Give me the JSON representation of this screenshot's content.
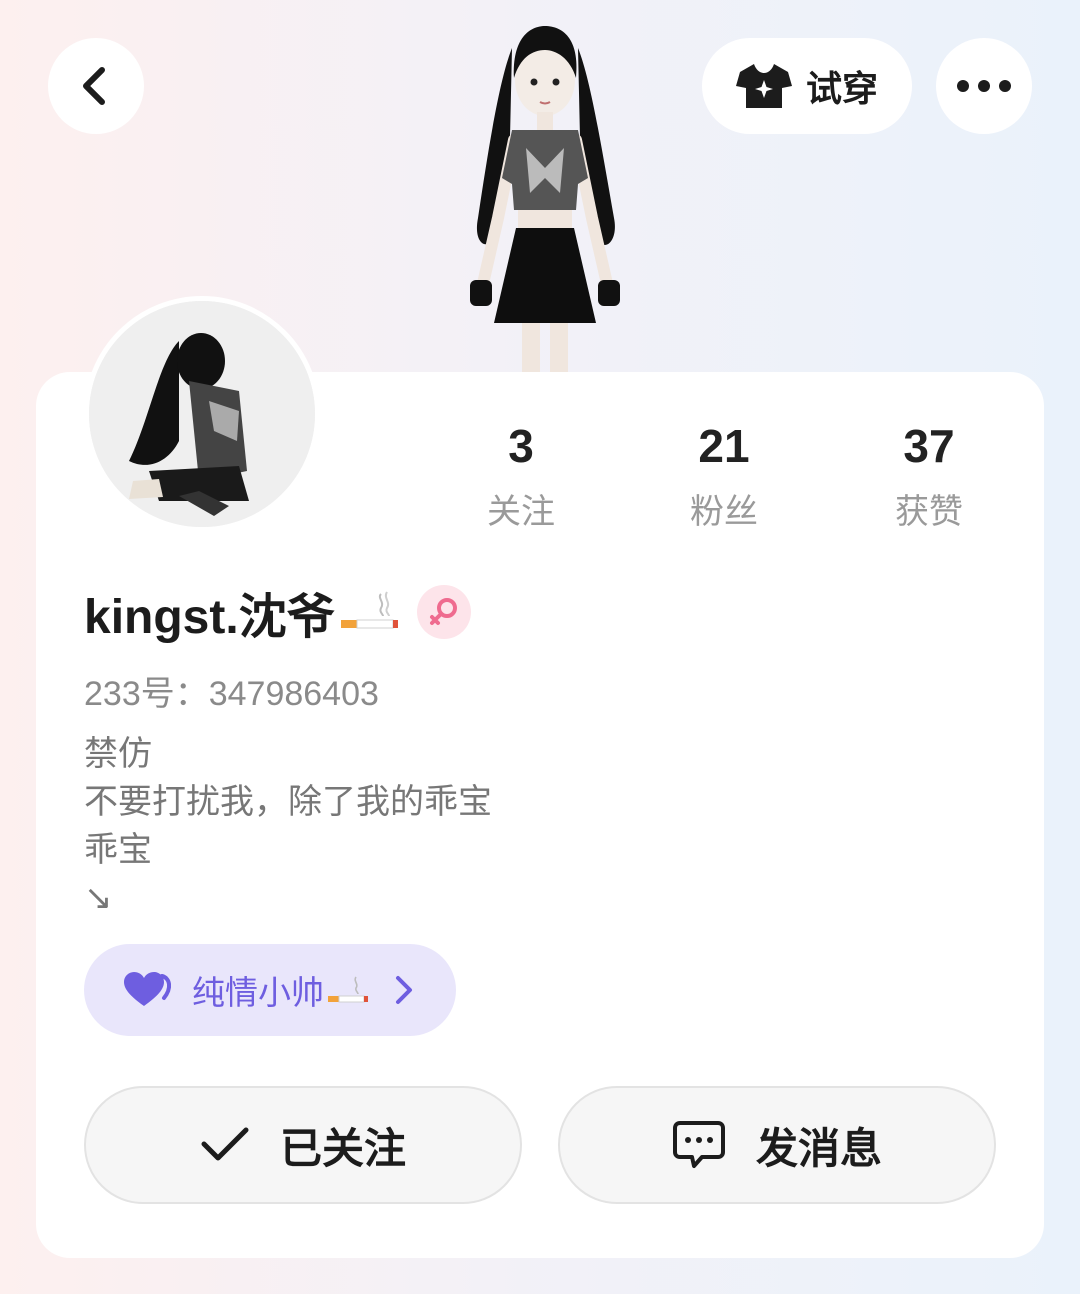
{
  "header": {
    "back_icon": "chevron-left-icon",
    "tryon_label": "试穿",
    "tryon_icon": "tshirt-sparkle-icon",
    "more_icon": "more-horizontal-icon"
  },
  "stats": [
    {
      "value": "3",
      "label": "关注"
    },
    {
      "value": "21",
      "label": "粉丝"
    },
    {
      "value": "37",
      "label": "获赞"
    }
  ],
  "profile": {
    "name": "kingst.沈爷",
    "name_emoji": "cigarette-icon",
    "gender_icon": "female-icon",
    "uid": "233号：347986403",
    "bio": [
      "禁仿",
      "不要打扰我，除了我的乖宝",
      "乖宝",
      "↘"
    ]
  },
  "relation_tag": {
    "text": "纯情小帅",
    "icon": "heart-icon",
    "accent": "#6e5ee0"
  },
  "actions": {
    "follow_label": "已关注",
    "message_label": "发消息"
  }
}
